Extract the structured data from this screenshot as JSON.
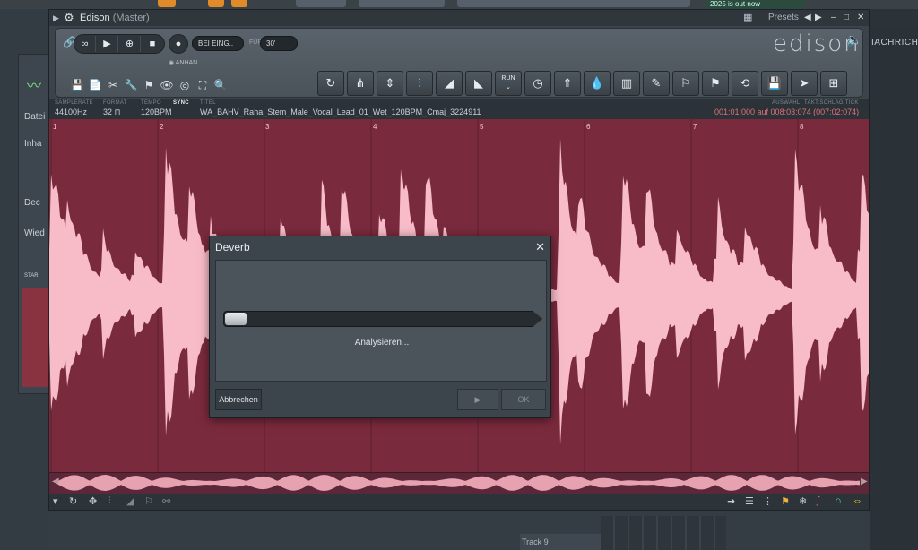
{
  "top": {
    "news": "2025 is out now"
  },
  "background": {
    "panel_labels": [
      "Datei",
      "Inha",
      "Dec",
      "Wied",
      "STAR"
    ],
    "nachrichten": "IACHRICHT",
    "track": "Track 9"
  },
  "window": {
    "title": "Edison",
    "subtitle": "(Master)",
    "presets_label": "Presets",
    "logo": "edison"
  },
  "transport": {
    "loop": "∞",
    "play": "▶",
    "target": "⊕",
    "stop": "■",
    "record": "●",
    "mode": "BEI EING..",
    "for_label": "FÜR",
    "duration": "30'",
    "anhang": "ANHAN."
  },
  "info": {
    "samplerate_label": "SAMPLERATE",
    "samplerate": "44100Hz",
    "format_label": "FORMAT",
    "format": "32",
    "tempo_label": "TEMPO",
    "tempo": "120BPM",
    "sync_label": "SYNC",
    "title_label": "TITEL",
    "title": "WA_BAHV_Raha_Stem_Male_Vocal_Lead_01_Wet_120BPM_Cmaj_3224911",
    "selection_label": "AUSWAHL",
    "timeline_label": "TAKT:SCHLAG:TICK",
    "selection": "001:01:000 auf 008:03:074 (007:02:074)"
  },
  "bars": [
    "1",
    "2",
    "3",
    "4",
    "5",
    "6",
    "7",
    "8"
  ],
  "toolbar_icons": [
    "reload-icon",
    "tune-icon",
    "split-icon",
    "eq-icon",
    "fade-in-icon",
    "fade-out-icon",
    "run-icon",
    "clock-icon",
    "rocket-icon",
    "drop-icon",
    "spectrum-icon",
    "feather-icon",
    "marker-add-icon",
    "marker-move-icon",
    "loop-icon",
    "save-icon",
    "cursor-icon",
    "export-icon"
  ],
  "toolbar_run_label": "RUN",
  "dialog": {
    "title": "Deverb",
    "close": "✕",
    "status": "Analysieren...",
    "cancel": "Abbrechen",
    "play": "▶",
    "ok": "OK",
    "progress": 0.03
  },
  "colors": {
    "wave_bg": "#7a2a3d",
    "wave": "#f7bcc7",
    "accent": "#e08a2a"
  }
}
